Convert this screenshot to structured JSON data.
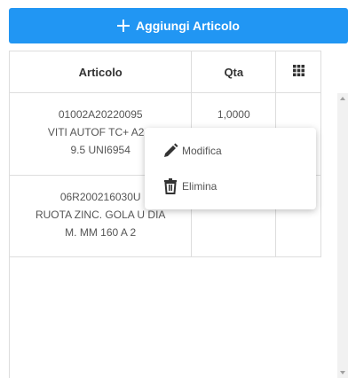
{
  "toolbar": {
    "add_label": "Aggiungi Articolo",
    "add_icon": "plus-icon"
  },
  "table": {
    "headers": {
      "articolo": "Articolo",
      "qta": "Qta",
      "columns_icon": "grid-icon"
    },
    "rows": [
      {
        "lines": [
          "01002A20220095",
          "VITI AUTOF TC+ A2 3",
          "9.5 UNI6954"
        ],
        "qta": "1,0000",
        "action_icon": "menu-icon"
      },
      {
        "lines": [
          "06R200216030U",
          "RUOTA ZINC. GOLA U DIA",
          "M. MM 160 A 2"
        ],
        "qta": "",
        "action_icon": ""
      }
    ]
  },
  "row_menu": {
    "items": [
      {
        "label": "Modifica",
        "icon": "pencil-icon"
      },
      {
        "label": "Elimina",
        "icon": "trash-icon"
      }
    ]
  },
  "colors": {
    "accent": "#2196f3",
    "border": "#dddddd",
    "text": "#555555"
  }
}
